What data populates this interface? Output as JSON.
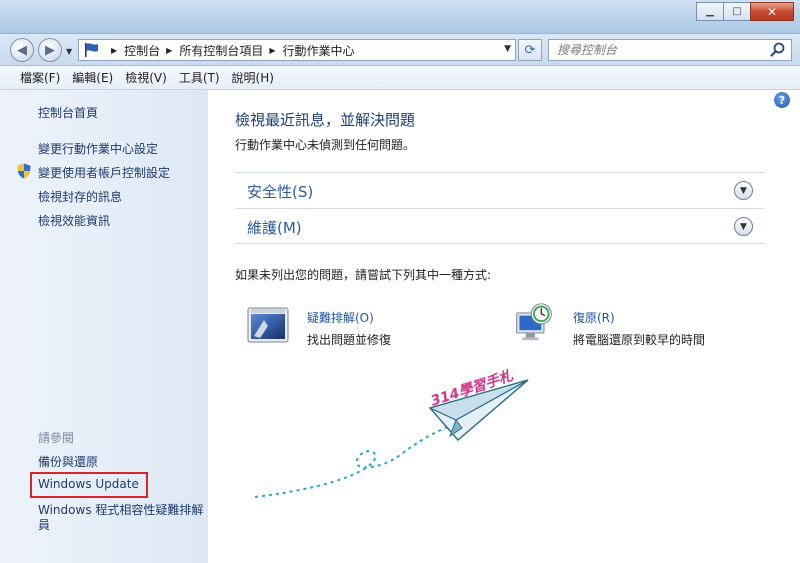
{
  "window": {
    "title": "",
    "buttons": {
      "minimize": "▁",
      "maximize": "□",
      "close": "✕"
    }
  },
  "address": {
    "breadcrumbs": [
      "控制台",
      "所有控制台項目",
      "行動作業中心"
    ],
    "search_placeholder": "搜尋控制台"
  },
  "menu": {
    "items": [
      "檔案(F)",
      "編輯(E)",
      "檢視(V)",
      "工具(T)",
      "說明(H)"
    ]
  },
  "sidebar": {
    "home": "控制台首頁",
    "links": [
      "變更行動作業中心設定",
      "變更使用者帳戶控制設定",
      "檢視封存的訊息",
      "檢視效能資訊"
    ],
    "see_also_label": "請參閱",
    "see_also": [
      "備份與還原",
      "Windows Update",
      "Windows 程式相容性疑難排解員"
    ]
  },
  "main": {
    "heading": "檢視最近訊息，並解決問題",
    "subtext": "行動作業中心未偵測到任何問題。",
    "sections": [
      {
        "title": "安全性(S)"
      },
      {
        "title": "維護(M)"
      }
    ],
    "hint": "如果未列出您的問題，請嘗試下列其中一種方式:",
    "tools": [
      {
        "title": "疑難排解(O)",
        "desc": "找出問題並修復",
        "icon": "troubleshoot-icon"
      },
      {
        "title": "復原(R)",
        "desc": "將電腦還原到較早的時間",
        "icon": "recovery-icon"
      }
    ]
  },
  "watermark": {
    "text": "314學習手札"
  },
  "colors": {
    "accent_link": "#1f55a6",
    "heading": "#1c3d7a",
    "highlight_box": "#d8262a",
    "watermark": "#d6358a"
  }
}
